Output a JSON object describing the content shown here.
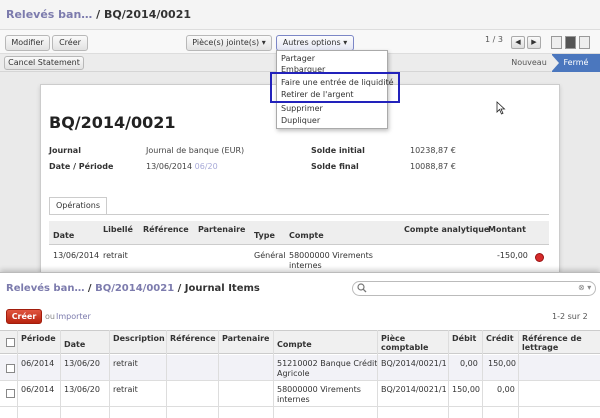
{
  "background": {
    "breadcrumb": {
      "parent": "Relevés ban…",
      "sep": " / ",
      "current": "BQ/2014/0021"
    },
    "toolbar": {
      "edit": "Modifier",
      "create": "Créer",
      "attachments": "Pièce(s) jointe(s) ▾",
      "more": "Autres options ▾"
    },
    "pager": {
      "text": "1 / 3",
      "prev": "◀",
      "next": "▶"
    },
    "statusbar": {
      "cancel": "Cancel Statement",
      "state_new": "Nouveau",
      "state_closed": "Fermé"
    },
    "more_menu": {
      "items": [
        "Partager",
        "Embarquer",
        "Faire une entrée de liquidité",
        "Retirer de l'argent",
        "Supprimer",
        "Dupliquer"
      ]
    },
    "sheet": {
      "title": "BQ/2014/0021",
      "journal_label": "Journal",
      "journal_value": "Journal de banque (EUR)",
      "date_label": "Date / Période",
      "date_value": "13/06/2014",
      "period_value": "06/20",
      "start_label": "Solde initial",
      "start_value": "10238,87 €",
      "end_label": "Solde final",
      "end_value": "10088,87 €",
      "tab": "Opérations",
      "headers": [
        "Date",
        "Libellé",
        "Référence",
        "Partenaire",
        "Type",
        "Compte",
        "Compte analytique",
        "Montant"
      ],
      "line": {
        "date": "13/06/2014",
        "label": "retrait",
        "type": "Général",
        "account_1": "58000000 Virements",
        "account_2": "internes",
        "amount": "-150,00"
      }
    }
  },
  "popup": {
    "breadcrumb": {
      "parent": "Relevés ban…",
      "mid": "BQ/2014/0021",
      "current": "Journal Items",
      "sep": " / "
    },
    "search": {
      "clear": "⊗ ▾"
    },
    "create": "Créer",
    "or": "ou",
    "import": "Importer",
    "pager": "1-2 sur 2",
    "headers": {
      "period": "Période",
      "date": "Date",
      "description": "Description",
      "reference": "Référence",
      "partner": "Partenaire",
      "account": "Compte",
      "move_1": "Pièce",
      "move_2": "comptable",
      "debit": "Débit",
      "credit": "Crédit",
      "rec_1": "Référence de",
      "rec_2": "lettrage"
    },
    "rows": [
      {
        "period": "06/2014",
        "date": "13/06/20",
        "description": "retrait",
        "account_1": "51210002 Banque Crédit",
        "account_2": "Agricole",
        "move": "BQ/2014/0021/1",
        "debit": "0,00",
        "credit": "150,00"
      },
      {
        "period": "06/2014",
        "date": "13/06/20",
        "description": "retrait",
        "account_1": "58000000 Virements",
        "account_2": "internes",
        "move": "BQ/2014/0021/1",
        "debit": "150,00",
        "credit": "0,00"
      }
    ]
  }
}
